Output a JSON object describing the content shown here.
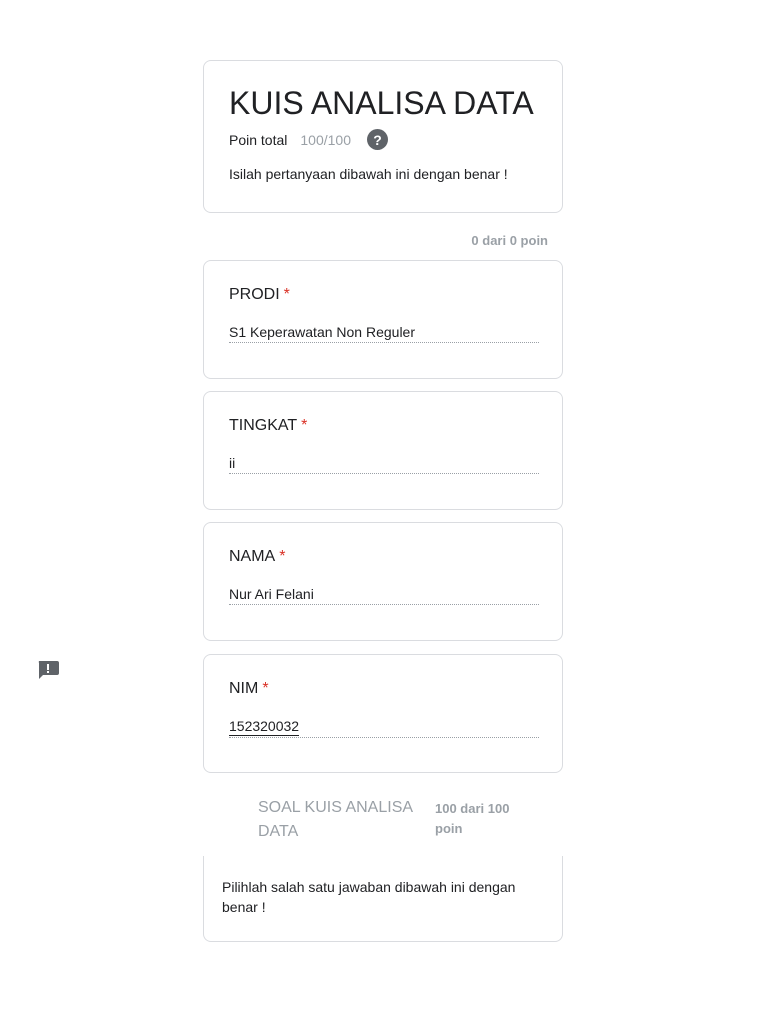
{
  "header": {
    "title": "KUIS ANALISA DATA",
    "points_label": "Poin total",
    "points_value": "100/100",
    "help_icon": "?",
    "description": "Isilah pertanyaan dibawah ini dengan benar !"
  },
  "section1": {
    "points": "0 dari 0 poin"
  },
  "questions": [
    {
      "label": "PRODI",
      "required": "*",
      "answer": "S1 Keperawatan Non Reguler"
    },
    {
      "label": "TINGKAT",
      "required": "*",
      "answer": "ii"
    },
    {
      "label": "NAMA",
      "required": "*",
      "answer": "Nur Ari Felani"
    },
    {
      "label": "NIM",
      "required": "*",
      "answer": "152320032"
    }
  ],
  "section2": {
    "title": "SOAL KUIS ANALISA DATA",
    "points": "100 dari 100 poin",
    "instruction": "Pilihlah salah satu jawaban dibawah ini dengan benar !"
  },
  "icons": {
    "feedback": "feedback-icon",
    "help": "help-icon"
  },
  "colors": {
    "required": "#d93025",
    "muted": "#9aa0a6",
    "border": "#dadce0"
  }
}
